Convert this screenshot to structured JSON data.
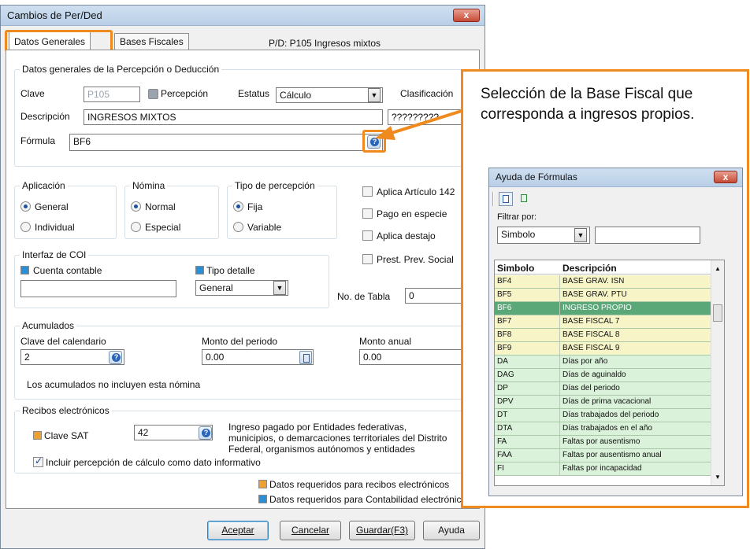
{
  "dialog": {
    "title": "Cambios de Per/Ded",
    "close_label": "x",
    "tabs": [
      {
        "label": "Datos Generales"
      },
      {
        "label": "Bases Fiscales"
      }
    ],
    "pd_header": "P/D: P105  Ingresos mixtos"
  },
  "general": {
    "legend": "Datos generales de la Percepción o Deducción",
    "clave_label": "Clave",
    "clave_value": "P105",
    "percepcion_label": "Percepción",
    "estatus_label": "Estatus",
    "estatus_value": "Cálculo",
    "clasificacion_label": "Clasificación",
    "descripcion_label": "Descripción",
    "descripcion_value": "INGRESOS MIXTOS",
    "clasificacion_value": "?????????",
    "formula_label": "Fórmula",
    "formula_value": "BF6"
  },
  "aplicacion": {
    "legend": "Aplicación",
    "options": [
      "General",
      "Individual"
    ],
    "selected": 0
  },
  "nomina": {
    "legend": "Nómina",
    "options": [
      "Normal",
      "Especial"
    ],
    "selected": 0
  },
  "tipo_percepcion": {
    "legend": "Tipo de percepción",
    "options": [
      "Fija",
      "Variable"
    ],
    "selected": 0
  },
  "checks": [
    {
      "label": "Aplica Artículo 142",
      "checked": false
    },
    {
      "label": "Pago en especie",
      "checked": false
    },
    {
      "label": "Aplica destajo",
      "checked": false
    },
    {
      "label": "Prest. Prev. Social",
      "checked": false
    }
  ],
  "coi": {
    "legend": "Interfaz de COI",
    "cuenta_label": "Cuenta contable",
    "cuenta_value": "",
    "tipo_label": "Tipo detalle",
    "tipo_value": "General"
  },
  "tabla": {
    "label": "No. de Tabla",
    "value": "0"
  },
  "acumulados": {
    "legend": "Acumulados",
    "clave_label": "Clave del calendario",
    "clave_value": "2",
    "monto_periodo_label": "Monto del periodo",
    "monto_periodo_value": "0.00",
    "monto_anual_label": "Monto anual",
    "monto_anual_value": "0.00",
    "note": "Los acumulados no incluyen esta nómina"
  },
  "recibos": {
    "legend": "Recibos electrónicos",
    "clave_sat_label": "Clave SAT",
    "clave_sat_value": "42",
    "description": [
      "Ingreso pagado por Entidades federativas,",
      "municipios, o demarcaciones territoriales del Distrito",
      "Federal, organismos autónomos y entidades"
    ],
    "incluir_label": "Incluir percepción de cálculo como dato informativo",
    "incluir_checked": true
  },
  "legend_notes": [
    {
      "label": "Datos requeridos para recibos electrónicos",
      "color": "#f0a030"
    },
    {
      "label": "Datos requeridos para Contabilidad electrónica",
      "color": "#2a8fd4"
    }
  ],
  "buttons": {
    "aceptar": "Aceptar",
    "cancelar": "Cancelar",
    "guardar": "Guardar(F3)",
    "ayuda": "Ayuda"
  },
  "callout": {
    "text": "Selección de la Base Fiscal que corresponda a ingresos propios.",
    "accent": "#ef8a1e"
  },
  "help_window": {
    "title": "Ayuda de Fórmulas",
    "close_label": "x",
    "filter_label": "Filtrar por:",
    "filter_value": "Simbolo",
    "search_value": "",
    "columns": [
      "Simbolo",
      "Descripción"
    ],
    "rows": [
      {
        "symbol": "BF4",
        "desc": "BASE GRAV. ISN",
        "color": "#f7f5c8"
      },
      {
        "symbol": "BF5",
        "desc": "BASE GRAV. PTU",
        "color": "#f7f5c8"
      },
      {
        "symbol": "BF6",
        "desc": "INGRESO PROPIO",
        "color": "#5aa878",
        "selected": true
      },
      {
        "symbol": "BF7",
        "desc": "BASE FISCAL 7",
        "color": "#f7f5c8"
      },
      {
        "symbol": "BF8",
        "desc": "BASE FISCAL 8",
        "color": "#f7f5c8"
      },
      {
        "symbol": "BF9",
        "desc": "BASE FISCAL 9",
        "color": "#f7f5c8"
      },
      {
        "symbol": "DA",
        "desc": "Días por año",
        "color": "#d9f2d9"
      },
      {
        "symbol": "DAG",
        "desc": "Días de aguinaldo",
        "color": "#d9f2d9"
      },
      {
        "symbol": "DP",
        "desc": "Días del periodo",
        "color": "#d9f2d9"
      },
      {
        "symbol": "DPV",
        "desc": "Días de prima vacacional",
        "color": "#d9f2d9"
      },
      {
        "symbol": "DT",
        "desc": "Días trabajados del periodo",
        "color": "#d9f2d9"
      },
      {
        "symbol": "DTA",
        "desc": "Días trabajados en el año",
        "color": "#d9f2d9"
      },
      {
        "symbol": "FA",
        "desc": "Faltas por ausentismo",
        "color": "#d9f2d9"
      },
      {
        "symbol": "FAA",
        "desc": "Faltas por ausentismo anual",
        "color": "#d9f2d9"
      },
      {
        "symbol": "FI",
        "desc": "Faltas por incapacidad",
        "color": "#d9f2d9"
      }
    ]
  }
}
